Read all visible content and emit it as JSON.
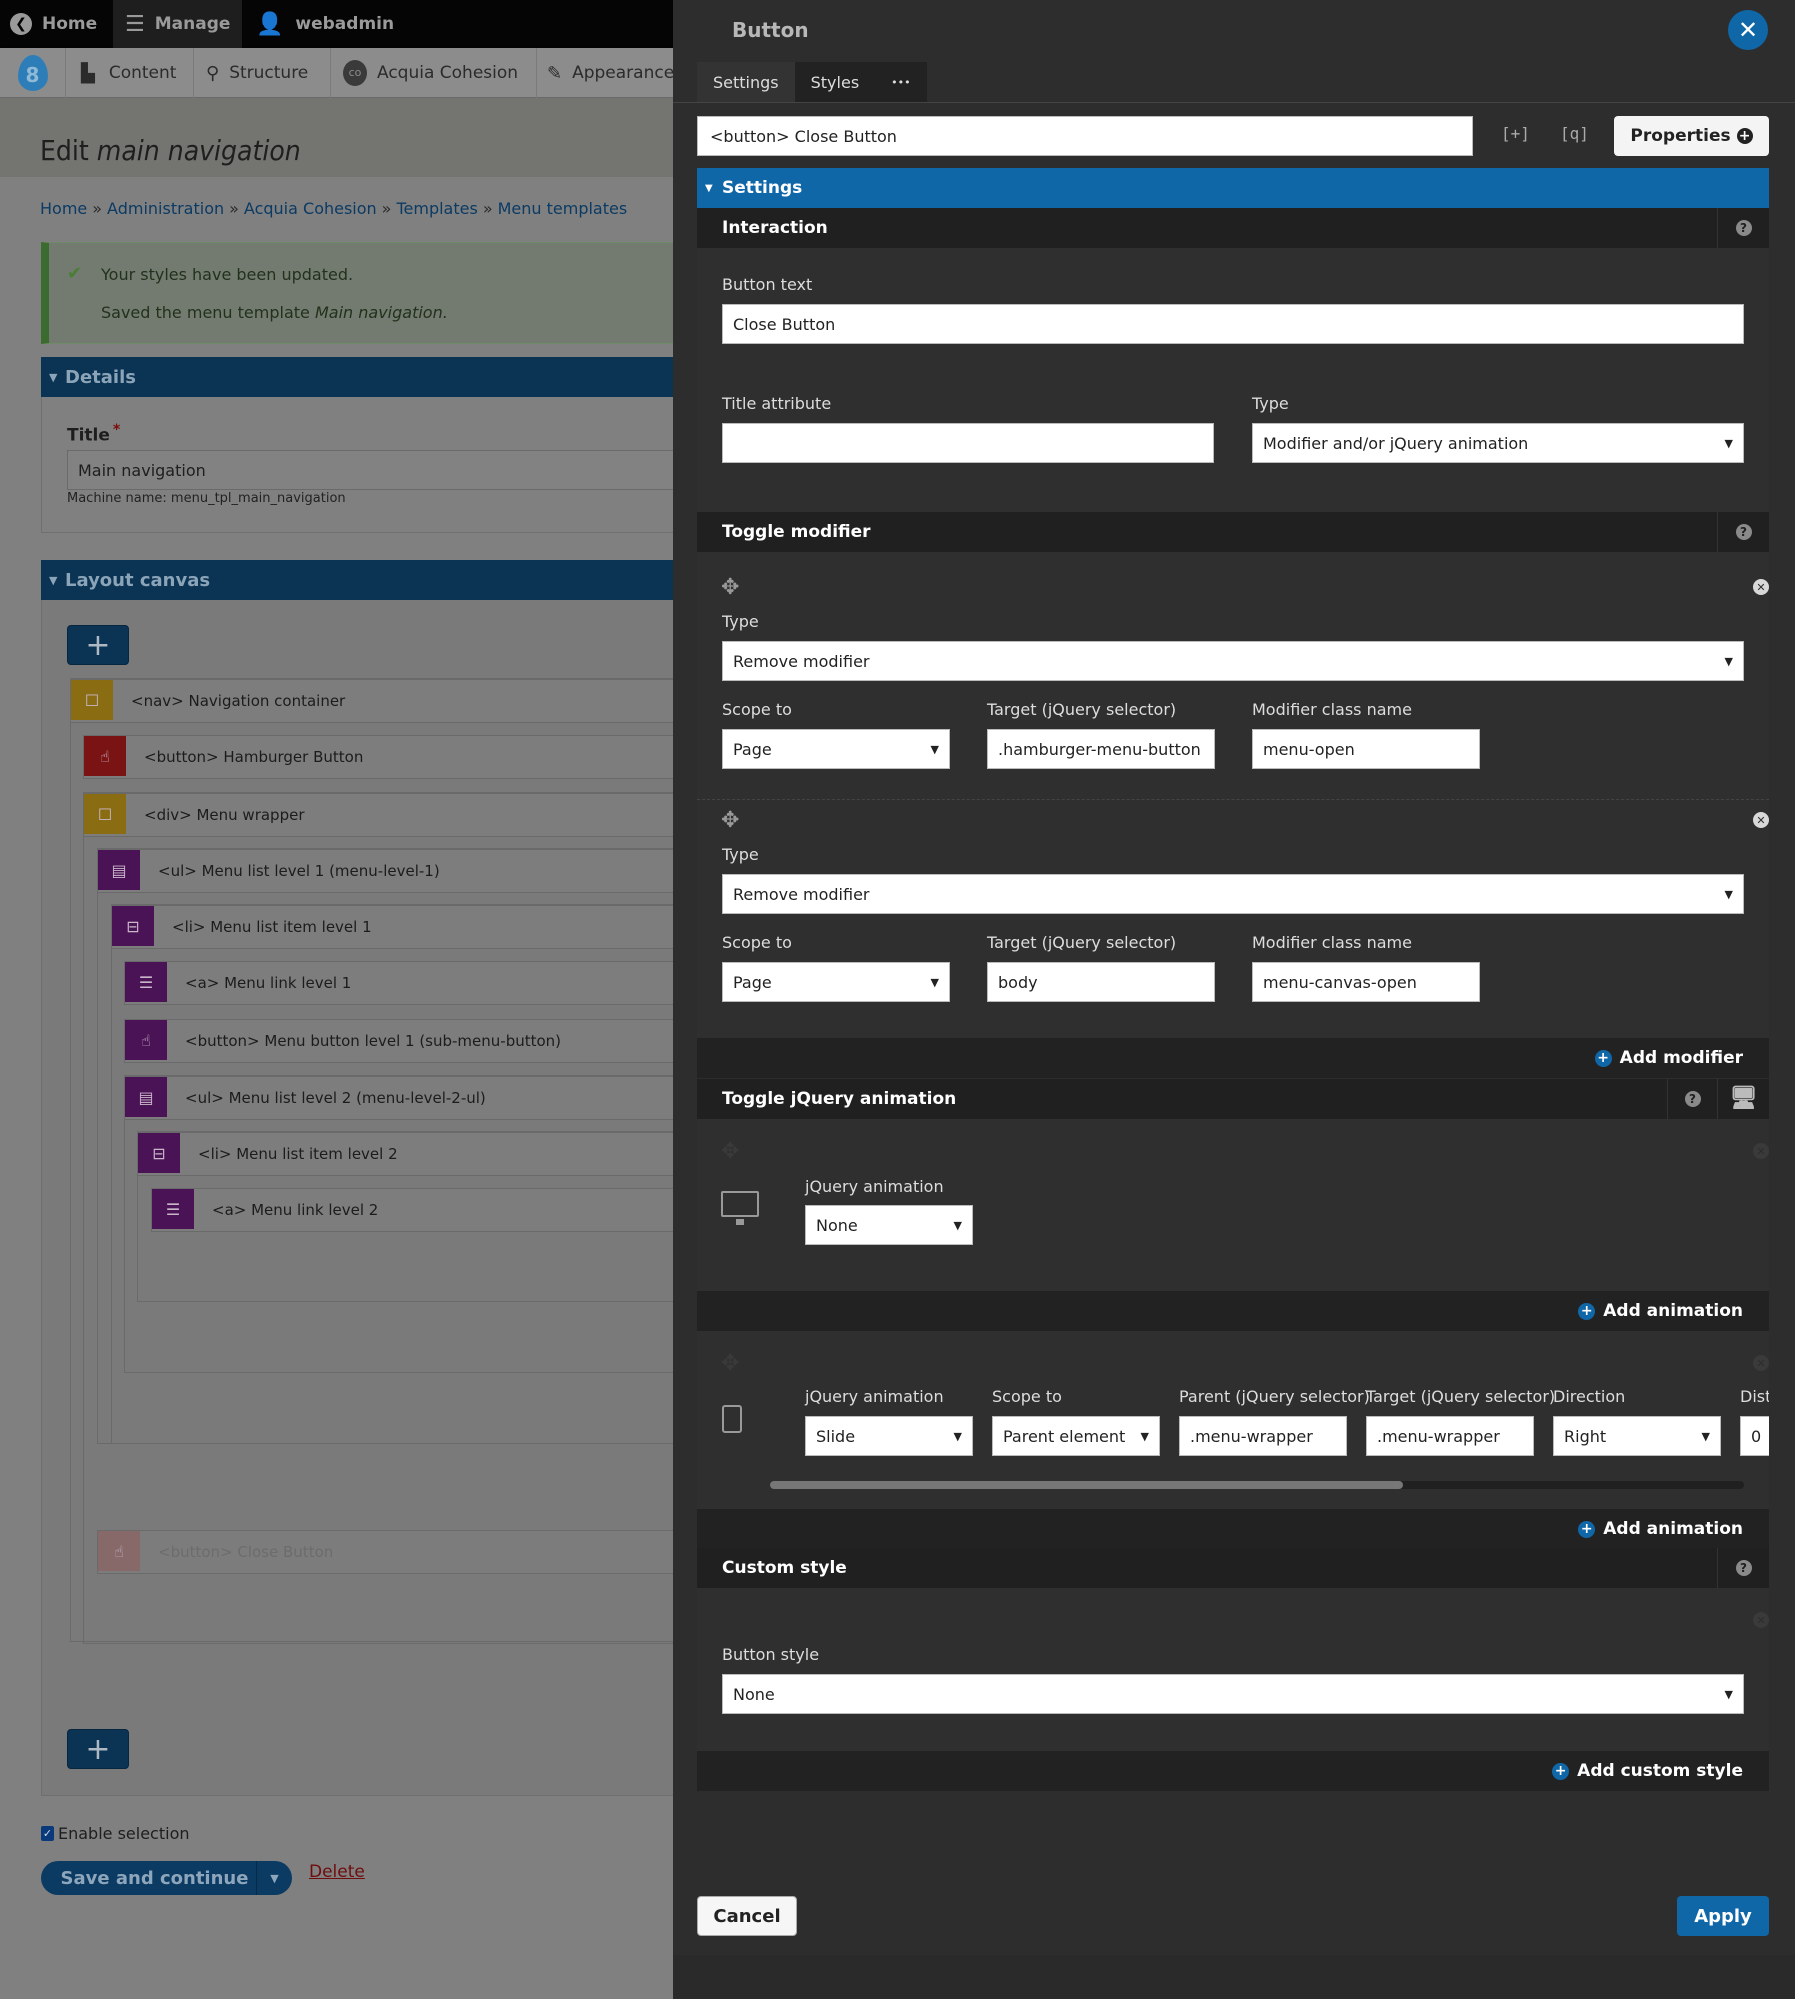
{
  "toolbar": {
    "items": [
      {
        "label": "Home",
        "icon": "back-circle-icon"
      },
      {
        "label": "Manage",
        "icon": "hamburger-icon"
      },
      {
        "label": "webadmin",
        "icon": "user-icon"
      }
    ],
    "tray": [
      {
        "label": "Content",
        "icon": "file-icon"
      },
      {
        "label": "Structure",
        "icon": "sitemap-icon"
      },
      {
        "label": "Acquia Cohesion",
        "icon": "cohesion-drop-icon"
      },
      {
        "label": "Appearance",
        "icon": "paintbrush-icon"
      }
    ]
  },
  "page": {
    "title_prefix": "Edit",
    "title_em": "main navigation",
    "breadcrumb": [
      "Home",
      "Administration",
      "Acquia Cohesion",
      "Templates",
      "Menu templates"
    ],
    "breadcrumb_sep": "»",
    "status": {
      "line1": "Your styles have been updated.",
      "line2_prefix": "Saved the menu template",
      "line2_em": "Main navigation."
    },
    "details": {
      "heading": "Details",
      "title_label": "Title",
      "required_mark": "*",
      "title_value": "Main navigation",
      "machine_name": "Machine name: menu_tpl_main_navigation"
    },
    "layout_canvas": {
      "heading": "Layout canvas",
      "add_label": "+",
      "tree": [
        {
          "label": "<nav> Navigation container",
          "icon": "container-icon",
          "color": "#8a6d12"
        },
        {
          "label": "<button> Hamburger Button",
          "icon": "pointer-hand-icon",
          "color": "#7a1414"
        },
        {
          "label": "<div> Menu wrapper",
          "icon": "container-icon",
          "color": "#8a6d12"
        },
        {
          "label": "<ul> Menu list level 1 (menu-level-1)",
          "icon": "list-icon",
          "color": "#4a1356"
        },
        {
          "label": "<li> Menu list item level 1",
          "icon": "list-item-icon",
          "color": "#4a1356"
        },
        {
          "label": "<a> Menu link level 1",
          "icon": "link-icon",
          "color": "#4a1356"
        },
        {
          "label": "<button> Menu button level 1 (sub-menu-button)",
          "icon": "pointer-hand-icon",
          "color": "#4a1356"
        },
        {
          "label": "<ul> Menu list level 2 (menu-level-2-ul)",
          "icon": "list-icon",
          "color": "#4a1356"
        },
        {
          "label": "<li> Menu list item level 2",
          "icon": "list-item-icon",
          "color": "#4a1356"
        },
        {
          "label": "<a> Menu link level 2",
          "icon": "link-icon",
          "color": "#4a1356"
        },
        {
          "label": "<button> Close Button",
          "icon": "pointer-hand-icon",
          "color": "#8a6868"
        }
      ]
    },
    "enable_selection_label": "Enable selection",
    "enable_selection_checked": true,
    "save_label": "Save and continue",
    "delete_label": "Delete"
  },
  "dialog": {
    "title": "Button",
    "tabs": [
      "Settings",
      "Styles",
      "•••"
    ],
    "active_tab": "Settings",
    "element_name": "<button> Close Button",
    "expand_icon_label": "[+]",
    "search_icon_label": "[q]",
    "properties_label": "Properties",
    "settings_heading": "Settings",
    "interaction": {
      "heading": "Interaction",
      "button_text_label": "Button text",
      "button_text_value": "Close Button",
      "title_attr_label": "Title attribute",
      "title_attr_value": "",
      "type_label": "Type",
      "type_value": "Modifier and/or jQuery animation"
    },
    "toggle_modifier": {
      "heading": "Toggle modifier",
      "modifiers": [
        {
          "type_label": "Type",
          "type": "Remove modifier",
          "scope_label": "Scope to",
          "scope": "Page",
          "target_label": "Target (jQuery selector)",
          "target": ".hamburger-menu-button",
          "class_label": "Modifier class name",
          "class_name": "menu-open"
        },
        {
          "type_label": "Type",
          "type": "Remove modifier",
          "scope_label": "Scope to",
          "scope": "Page",
          "target_label": "Target (jQuery selector)",
          "target": "body",
          "class_label": "Modifier class name",
          "class_name": "menu-canvas-open"
        }
      ],
      "add_label": "Add modifier"
    },
    "toggle_animation": {
      "heading": "Toggle jQuery animation",
      "desktop": {
        "anim_label": "jQuery animation",
        "anim": "None"
      },
      "add_label_1": "Add animation",
      "tablet": {
        "anim_label": "jQuery animation",
        "anim": "Slide",
        "scope_label": "Scope to",
        "scope": "Parent element",
        "parent_label": "Parent (jQuery selector)",
        "parent": ".menu-wrapper",
        "target_label": "Target (jQuery selector)",
        "target": ".menu-wrapper",
        "direction_label": "Direction",
        "direction": "Right",
        "distance_label": "Dist",
        "distance": "0"
      },
      "scroll_fraction": 0.65,
      "add_label_2": "Add animation"
    },
    "custom_style": {
      "heading": "Custom style",
      "style_label": "Button style",
      "style_value": "None",
      "add_label": "Add custom style"
    },
    "cancel_label": "Cancel",
    "apply_label": "Apply"
  },
  "colors": {
    "accent": "#1067a8",
    "panel_bg": "#2d2d2d",
    "section_header": "#202020"
  }
}
